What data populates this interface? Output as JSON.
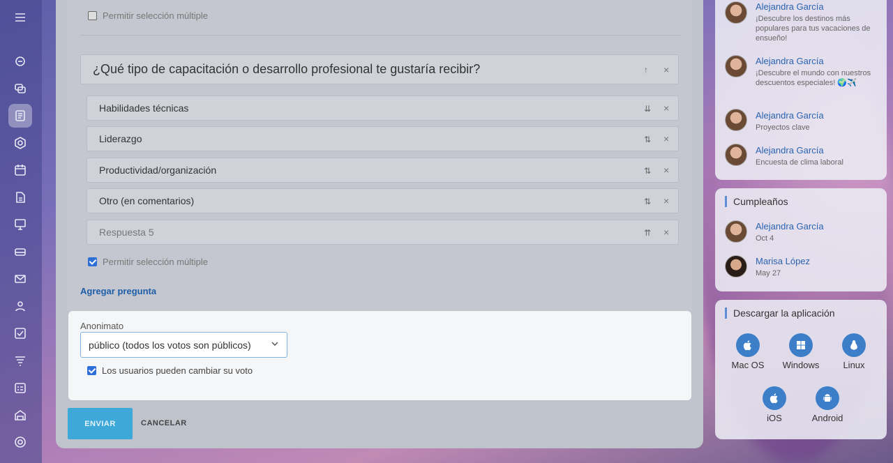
{
  "form": {
    "top_multi_select_label": "Permitir selección múltiple",
    "question": "¿Qué tipo de capacitación o desarrollo profesional te gustaría recibir?",
    "answers": [
      {
        "text": "Habilidades técnicas",
        "placeholder": false
      },
      {
        "text": "Liderazgo",
        "placeholder": false
      },
      {
        "text": "Productividad/organización",
        "placeholder": false
      },
      {
        "text": "Otro (en comentarios)",
        "placeholder": false
      },
      {
        "text": "Respuesta 5",
        "placeholder": true
      }
    ],
    "multi_select_label": "Permitir selección múltiple",
    "add_question_label": "Agregar pregunta",
    "anonymity_label": "Anonimato",
    "anonymity_value": "público (todos los votos son públicos)",
    "change_vote_label": "Los usuarios pueden cambiar su voto",
    "send_label": "ENVIAR",
    "cancel_label": "CANCELAR"
  },
  "feed": {
    "items": [
      {
        "name": "Alejandra García",
        "text": "¡Descubre los destinos más populares para tus vacaciones de ensueño!"
      },
      {
        "name": "Alejandra García",
        "text": "¡Descubre el mundo con nuestros descuentos especiales! 🌍✈️"
      },
      {
        "name": "Alejandra García",
        "text": "Proyectos clave"
      },
      {
        "name": "Alejandra García",
        "text": "Encuesta de clima laboral"
      }
    ]
  },
  "birthdays": {
    "title": "Cumpleaños",
    "items": [
      {
        "name": "Alejandra García",
        "date": "Oct 4"
      },
      {
        "name": "Marisa López",
        "date": "May 27"
      }
    ]
  },
  "apps": {
    "title": "Descargar la aplicación",
    "items": [
      "Mac OS",
      "Windows",
      "Linux",
      "iOS",
      "Android"
    ]
  },
  "colors": {
    "accent": "#3ea8d8",
    "link": "#2b63b0"
  }
}
